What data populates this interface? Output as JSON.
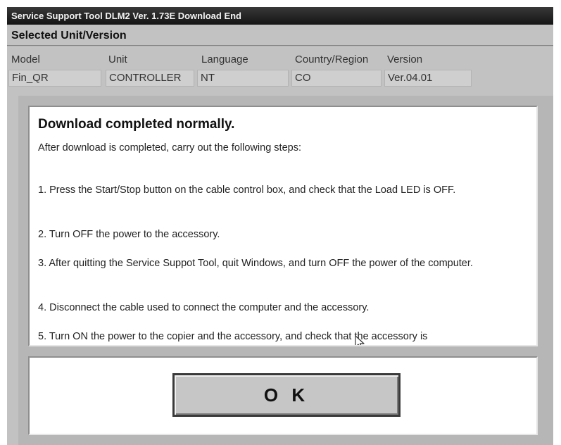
{
  "window": {
    "title": "Service Support Tool DLM2 Ver. 1.73E  Download End"
  },
  "selection": {
    "section_title": "Selected Unit/Version",
    "columns": [
      "Model",
      "Unit",
      "Language",
      "Country/Region",
      "Version"
    ],
    "values": [
      "Fin_QR",
      "CONTROLLER",
      "NT",
      "CO",
      "Ver.04.01"
    ]
  },
  "dialog": {
    "heading": "Download completed normally.",
    "intro": "After download is completed, carry out the following steps:",
    "steps": [
      "1. Press the Start/Stop button on the cable control box, and check that the Load LED is OFF.",
      "2. Turn OFF the power to the accessory.",
      "3. After quitting the Service Suppot Tool, quit Windows, and turn OFF the power of the computer.",
      "4. Disconnect the cable used to connect the computer and the accessory.",
      "5. Turn ON the power to the copier and the accessory, and check that the accessory is"
    ],
    "ok_label": "O K"
  }
}
